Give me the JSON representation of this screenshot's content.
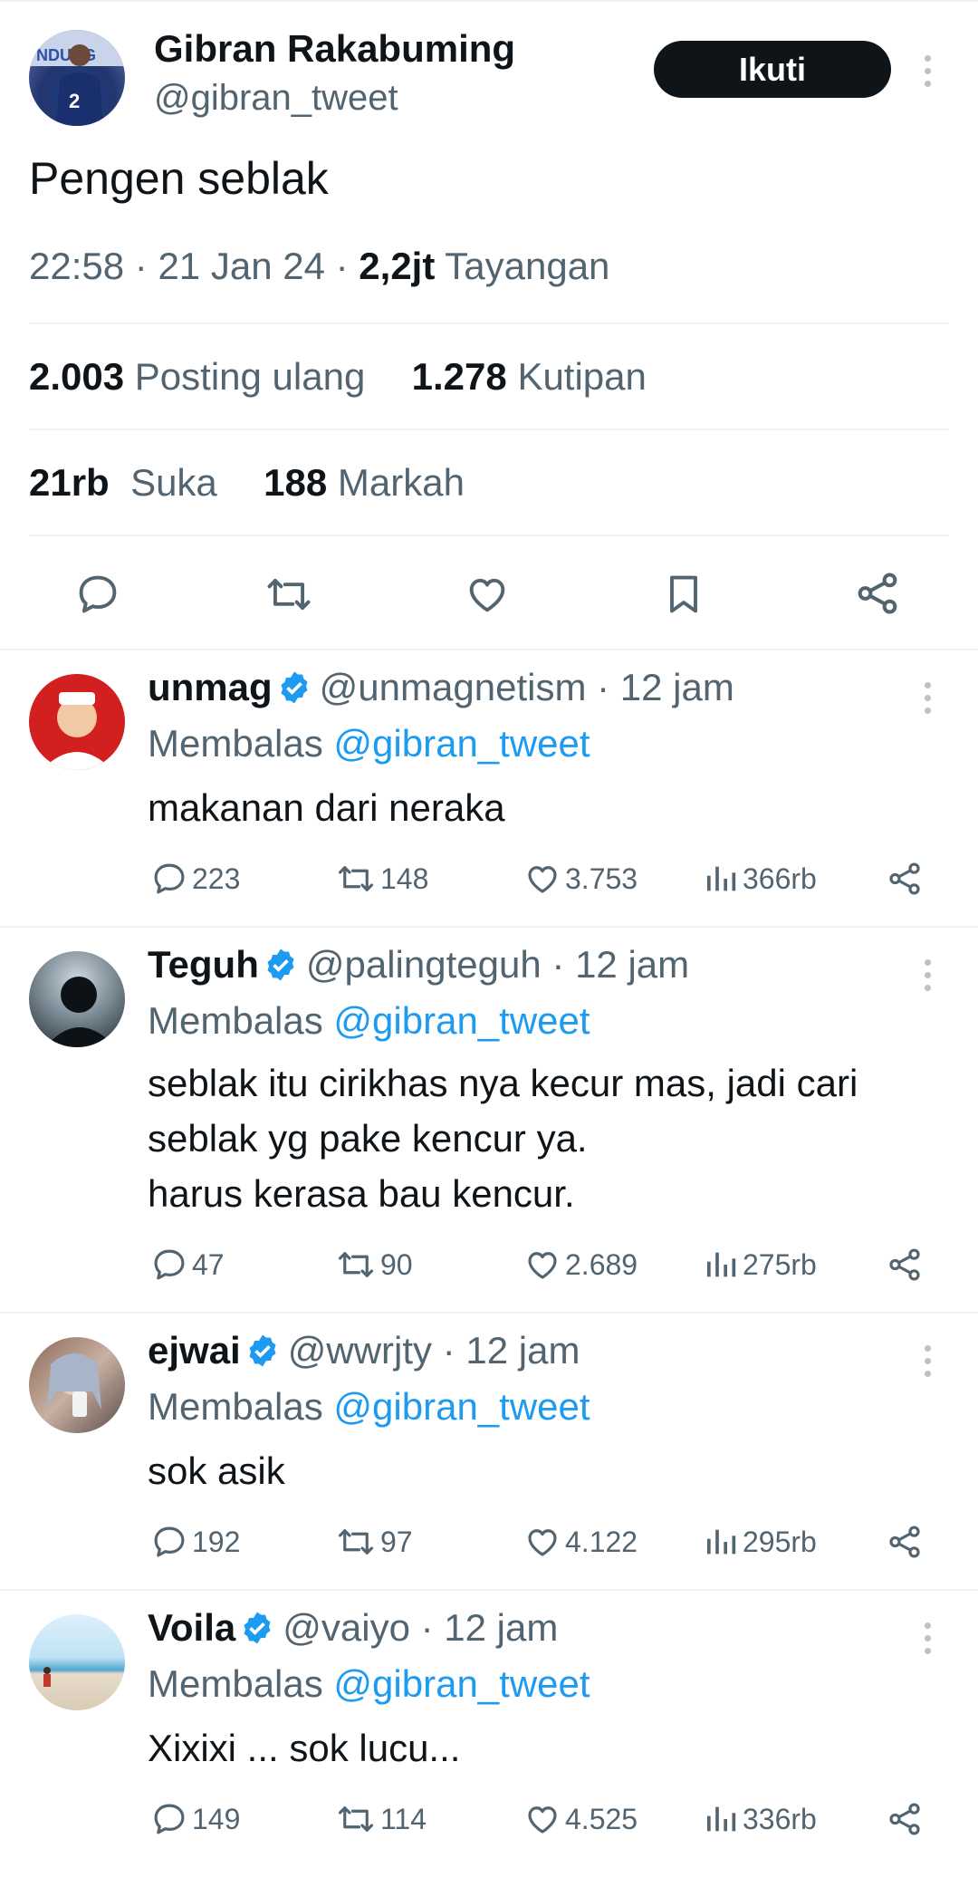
{
  "tweet": {
    "author_name": "Gibran Rakabuming",
    "author_handle": "@gibran_tweet",
    "follow_label": "Ikuti",
    "text": "Pengen seblak",
    "time": "22:58",
    "sep1": "·",
    "date": "21 Jan 24",
    "sep2": "·",
    "views": "2,2jt",
    "views_label": "Tayangan",
    "reposts": "2.003",
    "reposts_label": "Posting ulang",
    "quotes": "1.278",
    "quotes_label": "Kutipan",
    "likes": "21rb",
    "likes_label": "Suka",
    "bookmarks": "188",
    "bookmarks_label": "Markah"
  },
  "icons": {
    "reply": "reply-icon",
    "repost": "repost-icon",
    "like": "heart-icon",
    "bookmark": "bookmark-icon",
    "share": "share-icon",
    "views": "views-icon",
    "verified": "verified-badge-icon",
    "more": "more-icon"
  },
  "colors": {
    "accent": "#1d9bf0",
    "text": "#0f1419",
    "muted": "#536471",
    "separator": "#eff3f4"
  },
  "replies": [
    {
      "name": "unmag",
      "handle": "@unmagnetism",
      "dot": "·",
      "time": "12 jam",
      "replying_prefix": "Membalas",
      "replying_to": "@gibran_tweet",
      "lines": [
        "makanan dari neraka"
      ],
      "replies": "223",
      "reposts": "148",
      "likes": "3.753",
      "views": "366rb"
    },
    {
      "name": "Teguh",
      "handle": "@palingteguh",
      "dot": "·",
      "time": "12 jam",
      "replying_prefix": "Membalas",
      "replying_to": "@gibran_tweet",
      "lines": [
        "seblak itu cirikhas nya kecur mas, jadi cari",
        "seblak yg pake kencur ya.",
        "harus kerasa bau kencur."
      ],
      "replies": "47",
      "reposts": "90",
      "likes": "2.689",
      "views": "275rb"
    },
    {
      "name": "ejwai",
      "handle": "@wwrjty",
      "dot": "·",
      "time": "12 jam",
      "replying_prefix": "Membalas",
      "replying_to": "@gibran_tweet",
      "lines": [
        "sok asik"
      ],
      "replies": "192",
      "reposts": "97",
      "likes": "4.122",
      "views": "295rb"
    },
    {
      "name": "Voila",
      "handle": "@vaiyo",
      "dot": "·",
      "time": "12 jam",
      "replying_prefix": "Membalas",
      "replying_to": "@gibran_tweet",
      "lines": [
        "Xixixi ... sok lucu..."
      ],
      "replies": "149",
      "reposts": "114",
      "likes": "4.525",
      "views": "336rb"
    }
  ]
}
